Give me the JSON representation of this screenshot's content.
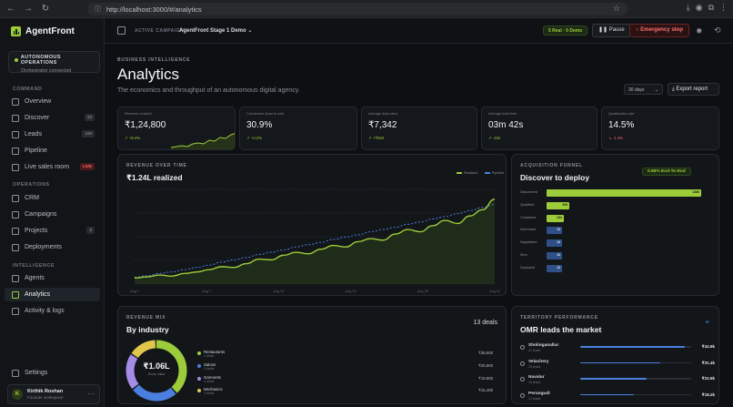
{
  "browser": {
    "url": "http://localhost:3000/#/analytics"
  },
  "sidebar": {
    "brand": "AgentFront",
    "status": {
      "title": "AUTONOMOUS OPERATIONS",
      "subtitle": "Orchestrator connected"
    },
    "sections": [
      "COMMAND",
      "OPERATIONS",
      "INTELLIGENCE"
    ],
    "command": [
      {
        "label": "Overview"
      },
      {
        "label": "Discover",
        "count": "20"
      },
      {
        "label": "Leads",
        "count": "100"
      },
      {
        "label": "Pipeline"
      },
      {
        "label": "Live sales room",
        "badge": "LIVE"
      }
    ],
    "operations": [
      {
        "label": "CRM"
      },
      {
        "label": "Campaigns"
      },
      {
        "label": "Projects",
        "count": "8"
      },
      {
        "label": "Deployments"
      }
    ],
    "intelligence": [
      {
        "label": "Agents"
      },
      {
        "label": "Analytics"
      },
      {
        "label": "Activity & logs"
      }
    ],
    "settings": "Settings",
    "user": {
      "initials": "K",
      "name": "Kirthik Roshan",
      "role": "Founder workspace"
    }
  },
  "topbar": {
    "label": "ACTIVE CAMPAIGN",
    "campaign": "AgentFront Stage 1 Demo",
    "real": "5 Real · 0 Demo",
    "pause": "Pause",
    "emergency": "Emergency stop"
  },
  "page": {
    "eyebrow": "BUSINESS INTELLIGENCE",
    "title": "Analytics",
    "subtitle": "The economics and throughput of an autonomous digital agency.",
    "period": "30 days",
    "export": "Export report"
  },
  "kpis": [
    {
      "label": "Revenue realized",
      "value": "₹1,24,800",
      "delta": "+8.4%",
      "dir": "up"
    },
    {
      "label": "Conversion (lead to win)",
      "value": "30.9%",
      "delta": "+4.2%",
      "dir": "up"
    },
    {
      "label": "Average deal value",
      "value": "₹7,342",
      "delta": "+₹684",
      "dir": "up"
    },
    {
      "label": "Average build time",
      "value": "03m 42s",
      "delta": "-23s",
      "dir": "up"
    },
    {
      "label": "Qualification rate",
      "value": "14.5%",
      "delta": "-1.3%",
      "dir": "dn"
    }
  ],
  "revenue": {
    "eyebrow": "REVENUE OVER TIME",
    "headline": "₹1.24L realized",
    "legend": [
      "Realized",
      "Pipeline"
    ]
  },
  "funnel": {
    "eyebrow": "ACQUISITION FUNNEL",
    "title": "Discover to deploy",
    "badge": "0.86% End-To-End"
  },
  "mix": {
    "eyebrow": "REVENUE MIX",
    "title": "By industry",
    "deals": "13 deals",
    "center_value": "₹1.06L",
    "center_label": "Gross value",
    "items": [
      {
        "name": "Restaurants",
        "sub": "4 deals",
        "value": "₹38,800",
        "color": "#9ccc3a"
      },
      {
        "name": "Salons",
        "sub": "3 deals",
        "value": "₹25,800",
        "color": "#4a7fe0"
      },
      {
        "name": "Garments",
        "sub": "3 deals",
        "value": "₹19,800",
        "color": "#a58ce6"
      },
      {
        "name": "Mechanics",
        "sub": "3 deals",
        "value": "₹15,400",
        "color": "#e0c64a"
      }
    ]
  },
  "territory": {
    "eyebrow": "TERRITORY PERFORMANCE",
    "title": "OMR leads the market",
    "rows": [
      {
        "name": "Sholinganallur",
        "sub": "21 leads",
        "value": "₹42.8k",
        "pct": 0.94
      },
      {
        "name": "Velachery",
        "sub": "18 leads",
        "value": "₹31.4k",
        "pct": 0.72
      },
      {
        "name": "Navalur",
        "sub": "15 leads",
        "value": "₹22.6k",
        "pct": 0.6
      },
      {
        "name": "Perungudi",
        "sub": "12 leads",
        "value": "₹18.2k",
        "pct": 0.48
      }
    ]
  },
  "chart_data": [
    {
      "type": "line",
      "title": "₹1.24L realized",
      "x": [
        "Aug 1",
        "Aug 7",
        "Aug 13",
        "Aug 19",
        "Aug 25",
        "Aug 31"
      ],
      "ylim": [
        0,
        125000
      ],
      "series": [
        {
          "name": "Realized",
          "values": [
            8000,
            9500,
            12000,
            10500,
            14000,
            16000,
            19000,
            23000,
            22000,
            27000,
            33000,
            32000,
            38000,
            42000,
            40000,
            46000,
            51000,
            49000,
            56000,
            60000,
            58000,
            66000,
            72000,
            69000,
            77000,
            84000,
            80000,
            90000,
            98000,
            112000
          ]
        },
        {
          "name": "Pipeline",
          "values": [
            9000,
            11000,
            14000,
            16000,
            19000,
            22000,
            25000,
            29000,
            32000,
            35000,
            39000,
            42000,
            45000,
            49000,
            52000,
            55000,
            59000,
            62000,
            65000,
            69000,
            72000,
            75000,
            79000,
            82000,
            86000,
            89000,
            93000,
            97000,
            101000,
            105000
          ]
        }
      ]
    },
    {
      "type": "bar",
      "title": "Discover to deploy",
      "categories": [
        "Discovered",
        "Qualified",
        "Contacted",
        "Interested",
        "Negotiated",
        "Won",
        "Deployed"
      ],
      "values": [
        1386,
        205,
        154,
        13,
        13,
        13,
        13
      ]
    },
    {
      "type": "pie",
      "title": "By industry",
      "categories": [
        "Restaurants",
        "Salons",
        "Garments",
        "Mechanics"
      ],
      "values": [
        38800,
        25800,
        19800,
        15400
      ]
    }
  ]
}
